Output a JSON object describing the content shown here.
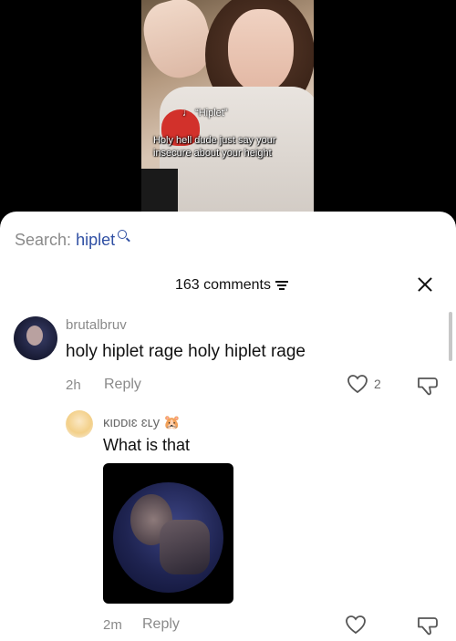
{
  "video": {
    "sound_label": "“Hiplet”",
    "caption_line1": "Holy hell dude just say your",
    "caption_line2": "insecure about your height"
  },
  "search": {
    "prefix": "Search:",
    "term": "hiplet"
  },
  "comments_header": {
    "count_label": "163 comments"
  },
  "comments": [
    {
      "username": "brutalbruv",
      "text": "holy hiplet rage holy hiplet rage",
      "time": "2h",
      "reply_label": "Reply",
      "likes": "2"
    }
  ],
  "reply": {
    "username": "κιᴅᴅιɛ ɛʟy 🐹",
    "text": "What is that",
    "time": "2m",
    "reply_label": "Reply",
    "likes": ""
  },
  "colors": {
    "accent": "#2f4fa3",
    "muted": "#8a8a8a",
    "text": "#111111"
  }
}
